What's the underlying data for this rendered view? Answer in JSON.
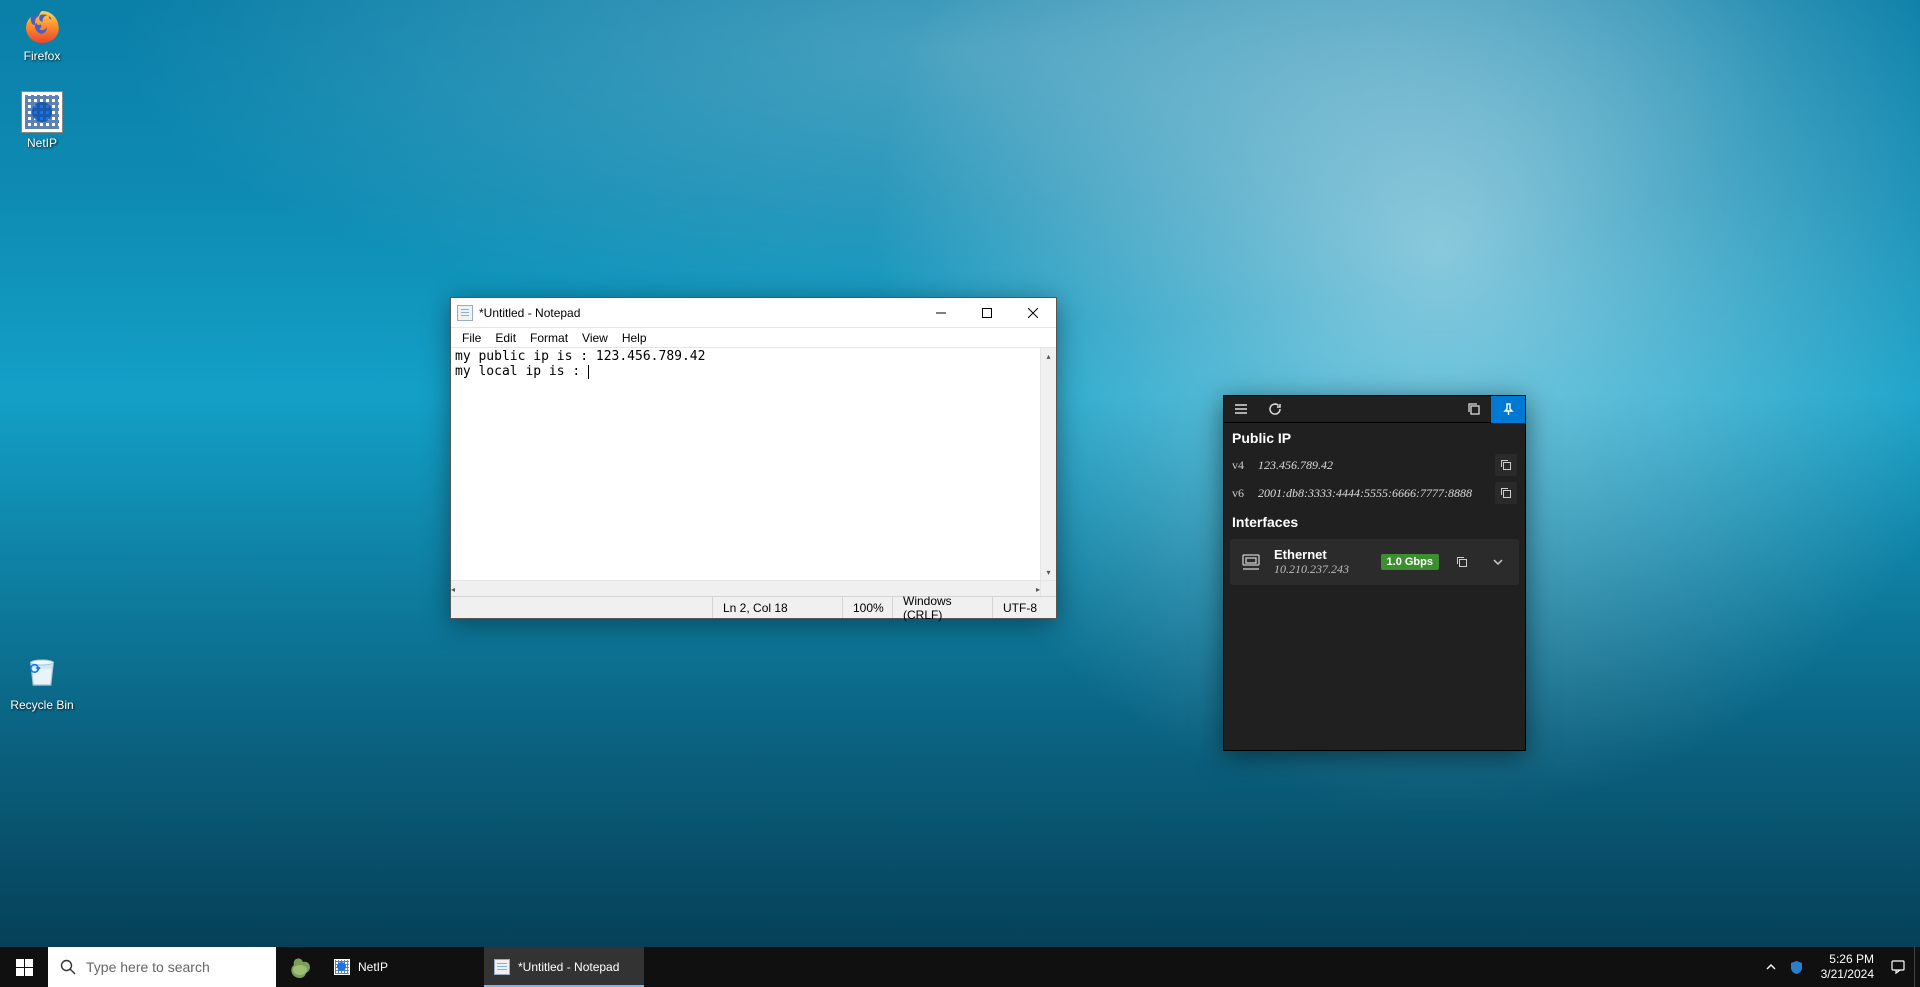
{
  "desktop": {
    "icons": [
      {
        "name": "firefox",
        "label": "Firefox"
      },
      {
        "name": "netip",
        "label": "NetIP"
      }
    ],
    "recycle_label": "Recycle Bin"
  },
  "notepad": {
    "title": "*Untitled - Notepad",
    "menu": [
      "File",
      "Edit",
      "Format",
      "View",
      "Help"
    ],
    "content_line1": "my public ip is : 123.456.789.42",
    "content_line2": "my local ip is : ",
    "status": {
      "position": "Ln 2, Col 18",
      "zoom": "100%",
      "eol": "Windows (CRLF)",
      "encoding": "UTF-8"
    }
  },
  "netip": {
    "sections": {
      "public_ip_title": "Public IP",
      "interfaces_title": "Interfaces"
    },
    "public": {
      "v4_label": "v4",
      "v4": "123.456.789.42",
      "v6_label": "v6",
      "v6": "2001:db8:3333:4444:5555:6666:7777:8888"
    },
    "iface": {
      "name": "Ethernet",
      "ip": "10.210.237.243",
      "speed": "1.0 Gbps"
    }
  },
  "taskbar": {
    "search_placeholder": "Type here to search",
    "items": [
      {
        "name": "netip",
        "label": "NetIP",
        "active": false
      },
      {
        "name": "notepad",
        "label": "*Untitled - Notepad",
        "active": true
      }
    ],
    "time": "5:26 PM",
    "date": "3/21/2024"
  }
}
